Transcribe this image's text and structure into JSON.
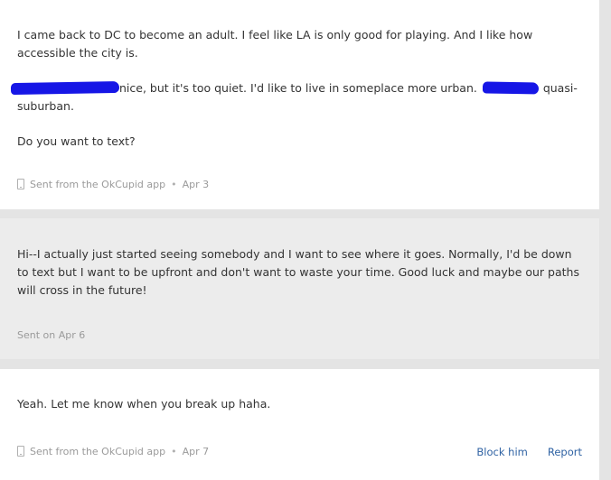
{
  "messages": [
    {
      "type": "received",
      "paragraph1": "I came back to DC to become an adult. I feel like LA is only good for playing. And I like how accessible the city is.",
      "paragraph2_part1": "nice, but it's too quiet. I'd like to live in someplace more urban.",
      "paragraph2_part2": "quasi-suburban.",
      "paragraph3": "Do you want to text?",
      "meta_label": "Sent from the OkCupid app",
      "meta_date": "Apr 3"
    },
    {
      "type": "sent",
      "paragraph1": "Hi--I actually just started seeing somebody and I want to see where it goes. Normally, I'd be down to text but I want to be upfront and don't want to waste your time. Good luck and maybe our paths will cross in the future!",
      "meta_label": "Sent on Apr 6"
    },
    {
      "type": "received",
      "paragraph1": "Yeah. Let me know when you break up haha.",
      "meta_label": "Sent from the OkCupid app",
      "meta_date": "Apr 7"
    }
  ],
  "actions": {
    "block_label": "Block him",
    "report_label": "Report"
  },
  "colors": {
    "page_background": "#e4e4e4",
    "received_background": "#ffffff",
    "sent_background": "#ececec",
    "link": "#2f62a3",
    "redaction": "#1616e6"
  },
  "icons": {
    "app_indicator": "phone-icon",
    "separator": "bullet-dot"
  }
}
